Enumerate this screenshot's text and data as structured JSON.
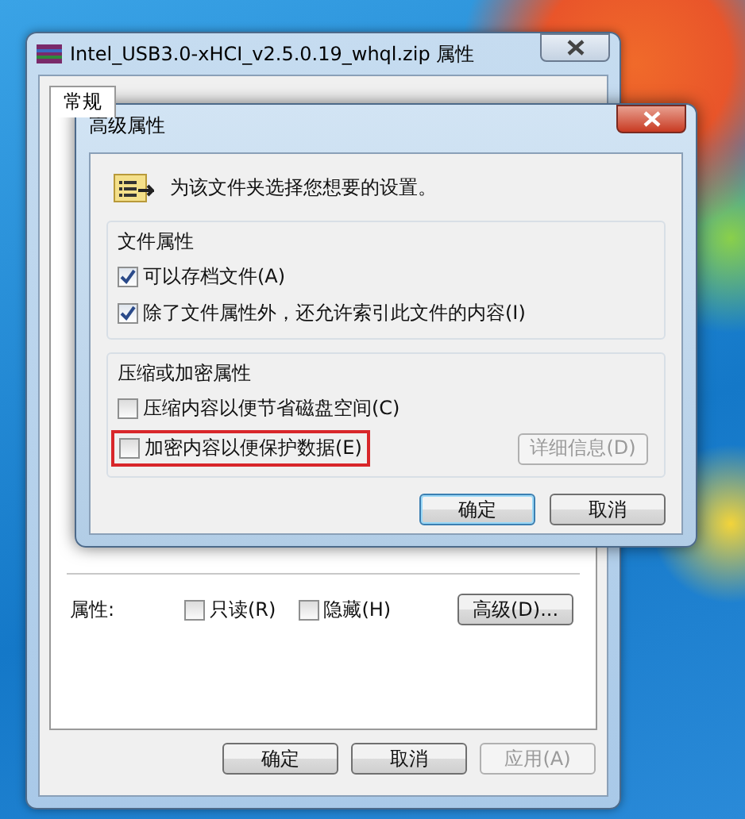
{
  "window": {
    "title": "Intel_USB3.0-xHCI_v2.5.0.19_whql.zip 属性",
    "tabs": [
      {
        "label": "常规",
        "selected": true
      }
    ],
    "attributes": {
      "label": "属性:",
      "checkboxes": [
        {
          "label": "只读(R)",
          "checked": false
        },
        {
          "label": "隐藏(H)",
          "checked": false
        }
      ],
      "advanced_button": "高级(D)..."
    },
    "buttons": [
      {
        "label": "确定",
        "disabled": false
      },
      {
        "label": "取消",
        "disabled": false
      },
      {
        "label": "应用(A)",
        "disabled": true
      }
    ]
  },
  "dialog": {
    "title": "高级属性",
    "intro": "为该文件夹选择您想要的设置。",
    "groups": [
      {
        "title": "文件属性",
        "options": [
          {
            "label": "可以存档文件(A)",
            "checked": true,
            "highlighted": false
          },
          {
            "label": "除了文件属性外，还允许索引此文件的内容(I)",
            "checked": true,
            "highlighted": false
          }
        ]
      },
      {
        "title": "压缩或加密属性",
        "options": [
          {
            "label": "压缩内容以便节省磁盘空间(C)",
            "checked": false,
            "highlighted": false
          },
          {
            "label": "加密内容以便保护数据(E)",
            "checked": false,
            "highlighted": true
          }
        ],
        "details_button": {
          "label": "详细信息(D)",
          "disabled": true
        }
      }
    ],
    "buttons": [
      {
        "label": "确定",
        "default": true
      },
      {
        "label": "取消",
        "default": false
      }
    ]
  }
}
